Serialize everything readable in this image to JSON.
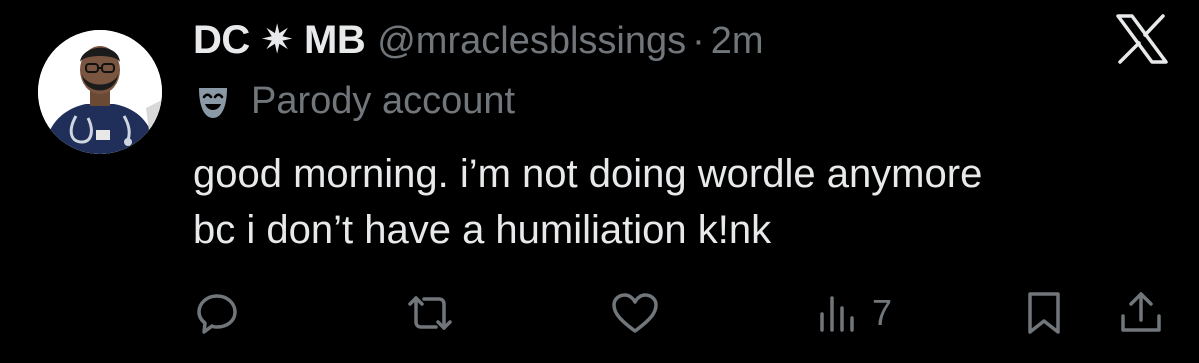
{
  "tweet": {
    "display_name": "DC ✷ MB",
    "handle": "@mraclesblssings",
    "separator": "·",
    "timestamp": "2m",
    "parody_label": "Parody account",
    "text_lines": [
      "good morning. i’m not doing wordle anymore",
      "bc i don’t have a humiliation k!nk"
    ]
  },
  "actions": {
    "reply_icon": "reply-icon",
    "repost_icon": "repost-icon",
    "like_icon": "heart-icon",
    "views_icon": "views-icon",
    "views_count": "7",
    "bookmark_icon": "bookmark-icon",
    "share_icon": "share-icon"
  },
  "colors": {
    "background": "#000000",
    "primary_text": "#e7e9ea",
    "secondary_text": "#71767b"
  }
}
